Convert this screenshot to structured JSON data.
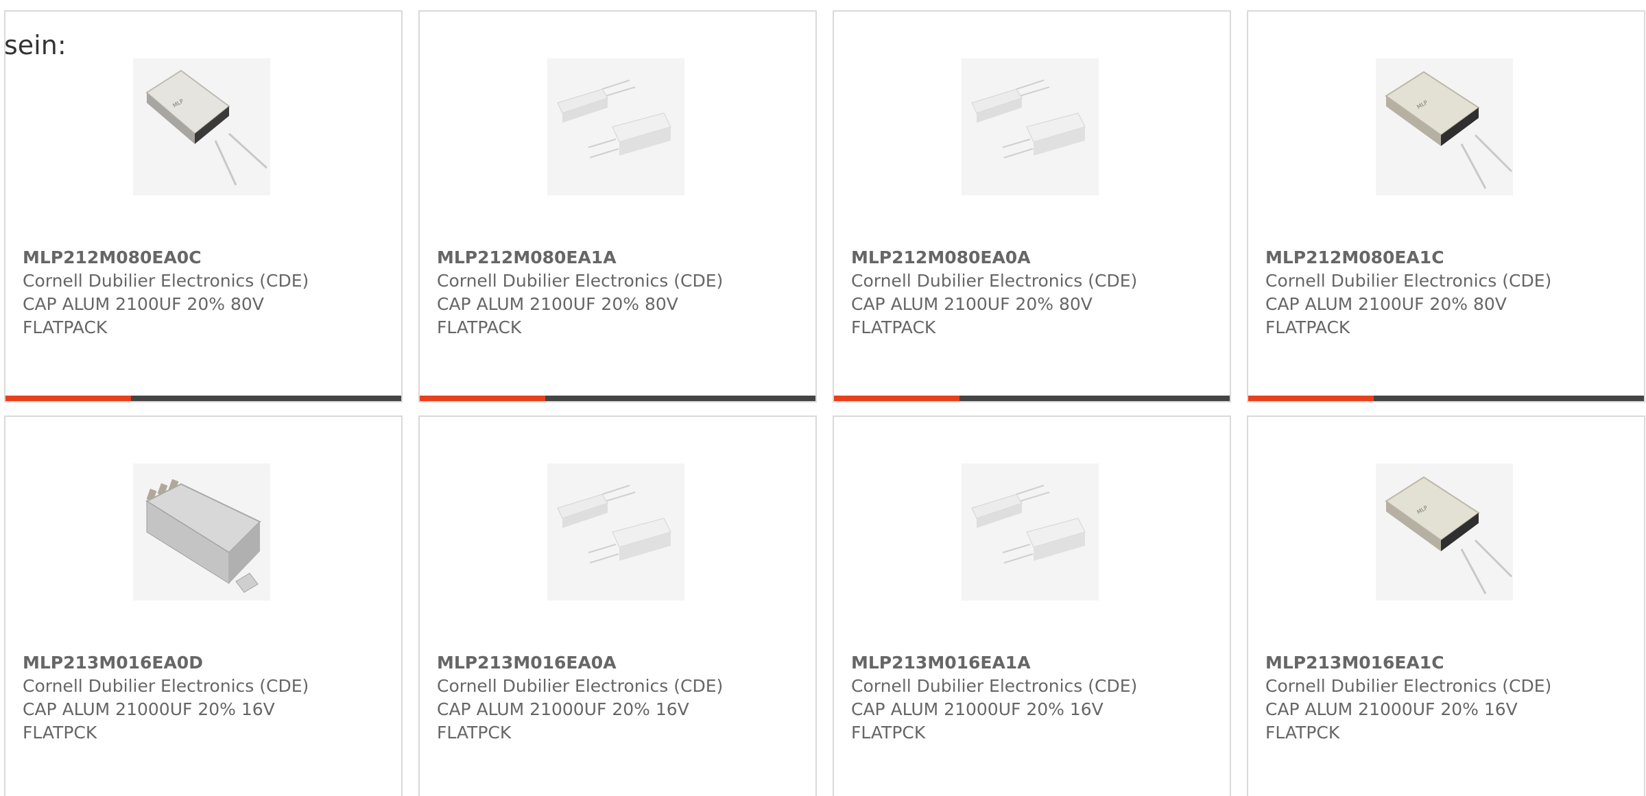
{
  "prefix_text": "sein:",
  "accent_color": "#e8401c",
  "products": [
    {
      "part_number": "MLP212M080EA0C",
      "manufacturer": "Cornell Dubilier Electronics (CDE)",
      "description_line1": "CAP ALUM 2100UF 20% 80V",
      "description_line2": "FLATPACK",
      "image_icon": "flatpack-capacitor-single-icon"
    },
    {
      "part_number": "MLP212M080EA1A",
      "manufacturer": "Cornell Dubilier Electronics (CDE)",
      "description_line1": "CAP ALUM 2100UF 20% 80V",
      "description_line2": "FLATPACK",
      "image_icon": "flatpack-capacitor-pair-icon"
    },
    {
      "part_number": "MLP212M080EA0A",
      "manufacturer": "Cornell Dubilier Electronics (CDE)",
      "description_line1": "CAP ALUM 2100UF 20% 80V",
      "description_line2": "FLATPACK",
      "image_icon": "flatpack-capacitor-pair-icon"
    },
    {
      "part_number": "MLP212M080EA1C",
      "manufacturer": "Cornell Dubilier Electronics (CDE)",
      "description_line1": "CAP ALUM 2100UF 20% 80V",
      "description_line2": "FLATPACK",
      "image_icon": "flatpack-capacitor-single-icon"
    },
    {
      "part_number": "MLP213M016EA0D",
      "manufacturer": "Cornell Dubilier Electronics (CDE)",
      "description_line1": "CAP ALUM 21000UF 20% 16V",
      "description_line2": "FLATPCK",
      "image_icon": "flatpack-capacitor-tab-icon"
    },
    {
      "part_number": "MLP213M016EA0A",
      "manufacturer": "Cornell Dubilier Electronics (CDE)",
      "description_line1": "CAP ALUM 21000UF 20% 16V",
      "description_line2": "FLATPCK",
      "image_icon": "flatpack-capacitor-pair-icon"
    },
    {
      "part_number": "MLP213M016EA1A",
      "manufacturer": "Cornell Dubilier Electronics (CDE)",
      "description_line1": "CAP ALUM 21000UF 20% 16V",
      "description_line2": "FLATPCK",
      "image_icon": "flatpack-capacitor-pair-icon"
    },
    {
      "part_number": "MLP213M016EA1C",
      "manufacturer": "Cornell Dubilier Electronics (CDE)",
      "description_line1": "CAP ALUM 21000UF 20% 16V",
      "description_line2": "FLATPCK",
      "image_icon": "flatpack-capacitor-single-icon"
    }
  ]
}
